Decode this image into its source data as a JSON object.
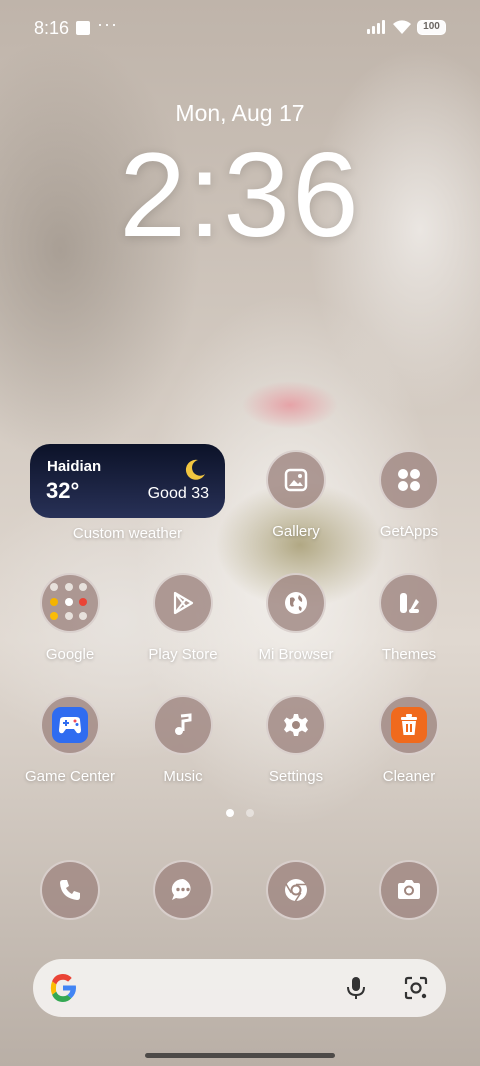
{
  "status_bar": {
    "time": "8:16",
    "more": "···",
    "battery": "100"
  },
  "lockscreen": {
    "date": "Mon, Aug 17",
    "time": "2:36"
  },
  "weather_widget": {
    "city": "Haidian",
    "temperature": "32°",
    "air_quality": "Good 33",
    "label": "Custom weather"
  },
  "apps": {
    "gallery": "Gallery",
    "getapps": "GetApps",
    "google": "Google",
    "play_store": "Play Store",
    "mi_browser": "Mi Browser",
    "themes": "Themes",
    "game_center": "Game Center",
    "music": "Music",
    "settings": "Settings",
    "cleaner": "Cleaner"
  },
  "pager": {
    "pages": 2,
    "current": 1
  },
  "dock": [
    "phone-icon",
    "messages-icon",
    "chrome-icon",
    "camera-icon"
  ],
  "colors": {
    "icon_bg": "#a0877f",
    "widget_bg": "#0c1228",
    "cleaner": "#f06a1d",
    "game_center": "#2f6cf0"
  }
}
